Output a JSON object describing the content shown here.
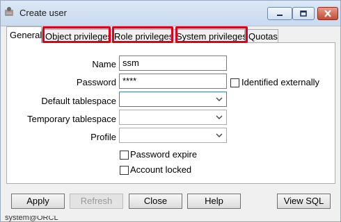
{
  "window": {
    "title": "Create user"
  },
  "tabs": [
    {
      "label": "General"
    },
    {
      "label": "Object privileges"
    },
    {
      "label": "Role privileges"
    },
    {
      "label": "System privileges"
    },
    {
      "label": "Quotas"
    }
  ],
  "form": {
    "name_label": "Name",
    "name_value": "ssm",
    "password_label": "Password",
    "password_value": "****",
    "identified_externally_label": "Identified externally",
    "identified_externally_checked": false,
    "default_tablespace_label": "Default tablespace",
    "default_tablespace_value": "",
    "temporary_tablespace_label": "Temporary tablespace",
    "temporary_tablespace_value": "",
    "profile_label": "Profile",
    "profile_value": "",
    "password_expire_label": "Password expire",
    "password_expire_checked": false,
    "account_locked_label": "Account locked",
    "account_locked_checked": false
  },
  "buttons": {
    "apply": "Apply",
    "refresh": "Refresh",
    "close": "Close",
    "help": "Help",
    "view_sql": "View SQL"
  },
  "status": {
    "text": "system@ORCL"
  },
  "colors": {
    "highlight": "#e0001b",
    "focus_border": "#3c7fb1"
  }
}
